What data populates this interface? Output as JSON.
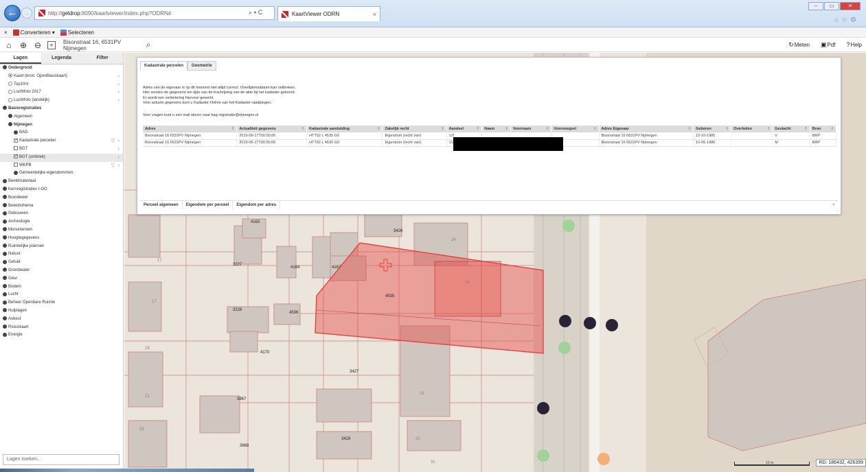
{
  "browser": {
    "url_prefix": "http://",
    "url_host": "geldrop",
    "url_rest": ":8090/kaartviewer/index.php?ODRN#",
    "address_tools": "⌕ ▾ C",
    "tab_title": "KaartViewer ODRN",
    "tab_close": "×"
  },
  "command_bar": {
    "close": "×",
    "convert_label": "Converteren",
    "convert_arrow": "▾",
    "select_label": "Selecteren"
  },
  "toolbar": {
    "address_value": "Bisonstraat 16, 6531PV Nijmegen",
    "measure_label": "Meten",
    "pdf_label": "Pdf",
    "help_label": "Help"
  },
  "left_panel": {
    "tabs": [
      "Lagen",
      "Legenda",
      "Filter"
    ],
    "items": [
      {
        "label": "Ondergrond",
        "type": "dot",
        "indent": 4,
        "bold": true
      },
      {
        "label": "Kaart (bron: OpenBasiskaart)",
        "type": "radio-on",
        "indent": 12,
        "chev": true
      },
      {
        "label": "Top10nl",
        "type": "radio",
        "indent": 12,
        "chev": true
      },
      {
        "label": "Luchtfoto 2017",
        "type": "radio",
        "indent": 12,
        "chev": true
      },
      {
        "label": "Luchtfoto (landelijk)",
        "type": "radio",
        "indent": 12,
        "chev": true
      },
      {
        "label": "Basisregistraties",
        "type": "dot",
        "indent": 4,
        "bold": true
      },
      {
        "label": "Algemeen",
        "type": "dot",
        "indent": 12
      },
      {
        "label": "Nijmegen",
        "type": "dot",
        "indent": 12,
        "bold": true
      },
      {
        "label": "BAG",
        "type": "dot",
        "indent": 20
      },
      {
        "label": "Kadastrale percelen",
        "type": "check-on",
        "indent": 20,
        "filter": true,
        "chev": true
      },
      {
        "label": "BGT",
        "type": "check",
        "indent": 20,
        "chev": true
      },
      {
        "label": "BGT (ombrek)",
        "type": "check-on",
        "indent": 20,
        "chev": true,
        "highlight": true
      },
      {
        "label": "WKPB",
        "type": "check",
        "indent": 20,
        "filter": true,
        "chev": true
      },
      {
        "label": "Gemeentelijke eigendommen",
        "type": "dot",
        "indent": 20
      },
      {
        "label": "Beeldmateriaal",
        "type": "dot",
        "indent": 4
      },
      {
        "label": "Kernregistraties I-GO",
        "type": "dot",
        "indent": 4
      },
      {
        "label": "Brandweer",
        "type": "dot",
        "indent": 4
      },
      {
        "label": "Beleidsthema",
        "type": "dot",
        "indent": 4
      },
      {
        "label": "Gebouwen",
        "type": "dot",
        "indent": 4
      },
      {
        "label": "Archeologie",
        "type": "dot",
        "indent": 4
      },
      {
        "label": "Monumenten",
        "type": "dot",
        "indent": 4
      },
      {
        "label": "Hoogtegegevens",
        "type": "dot",
        "indent": 4
      },
      {
        "label": "Ruimtelijke plannen",
        "type": "dot",
        "indent": 4
      },
      {
        "label": "Natuur",
        "type": "dot",
        "indent": 4
      },
      {
        "label": "Geluid",
        "type": "dot",
        "indent": 4
      },
      {
        "label": "Grondwater",
        "type": "dot",
        "indent": 4
      },
      {
        "label": "Geur",
        "type": "dot",
        "indent": 4
      },
      {
        "label": "Bodem",
        "type": "dot",
        "indent": 4
      },
      {
        "label": "Lucht",
        "type": "dot",
        "indent": 4
      },
      {
        "label": "Beheer Openbare Ruimte",
        "type": "dot",
        "indent": 4
      },
      {
        "label": "Hulplagen",
        "type": "dot",
        "indent": 4
      },
      {
        "label": "Asbest",
        "type": "dot",
        "indent": 4
      },
      {
        "label": "Risicokaart",
        "type": "dot",
        "indent": 4
      },
      {
        "label": "Energie",
        "type": "dot",
        "indent": 4
      }
    ],
    "search_placeholder": "Lagen zoeken..."
  },
  "info_panel": {
    "tabs": [
      "Kadastrale percelen",
      "Geometrie"
    ],
    "notes": [
      "Adres van de eigenaar is op dit moment niet altijd correct. Overlijdensdatum kan ontbreken.",
      "Hier worden de gegevens ten tijde van de inschrijving van de akte bij het kadaster getoond.",
      "Er wordt een verbetering hiervoor gewerkt.",
      "Voor actuele gegevens kunt u Kadaster-Online van het Kadaster raadplegen."
    ],
    "contact": "Voor vragen kunt u een mail sturen naar bag-registratie@nijmegen.nl",
    "columns": [
      "Adres",
      "Actualiteit gegevens",
      "Kadastrale aanduiding",
      "Zakelijk recht",
      "Aandeel",
      "Naam",
      "Voornaam",
      "Voorvoegsel",
      "Adres Eigenaar",
      "Geboren",
      "Overleden",
      "Geslacht",
      "Bron"
    ],
    "rows": [
      [
        "Bisonstraat 16 6531PV Nijmegen",
        "2019-06-17T00:00:00",
        "HTT02 L 4535 G0",
        "Eigendom (recht van)",
        "1/2",
        "",
        "",
        "",
        "Bisonstraat 16 6531PV Nijmegen",
        "12-10-1985",
        "",
        "V",
        "BRP"
      ],
      [
        "Bisonstraat 16 6531PV Nijmegen",
        "2019-06-17T00:00:00",
        "HTT02 L 4535 G0",
        "Eigendom (recht van)",
        "1/2",
        "",
        "",
        "",
        "Bisonstraat 16 6531PV Nijmegen",
        "10-05-1986",
        "",
        "M",
        "BRP"
      ]
    ],
    "bottom_tabs": [
      "Perceel algemeen",
      "Eigendom per perceel",
      "Eigendom per adres"
    ],
    "close_symbol": "×",
    "resize_symbol": "⌟"
  },
  "map": {
    "parcel_labels": [
      "4163",
      "3426",
      "3227",
      "4164",
      "4167",
      "4535",
      "3228",
      "4536",
      "4170",
      "3427",
      "3867",
      "3428",
      "3868"
    ],
    "house_numbers": [
      "24",
      "16",
      "17",
      "17",
      "19",
      "19",
      "21",
      "21",
      "23",
      "31"
    ],
    "scale_label": "10 m",
    "coordinates": "RD: 186432, 426399"
  },
  "colors": {
    "selected_parcel": "#e8413c",
    "building": "#cfc7bf",
    "parcel_border": "#c88080",
    "road": "#d9d2c8",
    "green_tree": "#9fd39a",
    "dark_point": "#2a2336",
    "orange_point": "#f2b078",
    "park": "#e0d7c8"
  }
}
